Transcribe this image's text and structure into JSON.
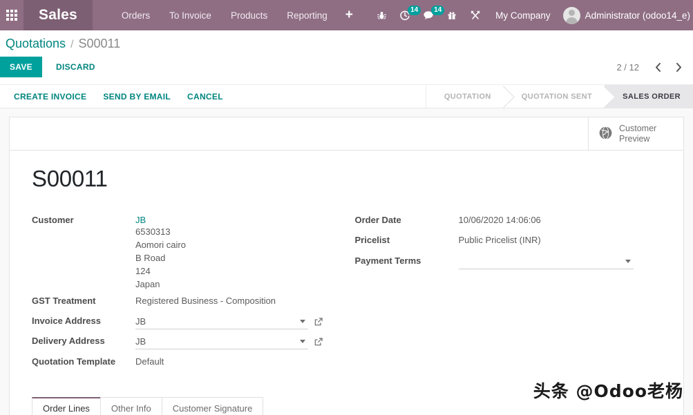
{
  "navbar": {
    "apps_icon": "apps-grid-icon",
    "brand": "Sales",
    "menu_items": [
      {
        "label": "Orders"
      },
      {
        "label": "To Invoice"
      },
      {
        "label": "Products"
      },
      {
        "label": "Reporting"
      }
    ],
    "plus_label": "+",
    "systray": [
      {
        "name": "debug-bug-icon",
        "badge": ""
      },
      {
        "name": "activity-clock-icon",
        "badge": "14"
      },
      {
        "name": "messages-chat-icon",
        "badge": "14"
      },
      {
        "name": "gift-icon",
        "badge": ""
      },
      {
        "name": "tools-wrench-icon",
        "badge": ""
      }
    ],
    "company": "My Company",
    "user": "Administrator (odoo14_e)",
    "badge_color": "#00a09d",
    "bg_color": "#8f6e84",
    "brand_bg_color": "#7d5f74"
  },
  "control_panel": {
    "breadcrumb": {
      "parent": "Quotations",
      "separator": "/",
      "current": "S00011"
    },
    "save_label": "SAVE",
    "discard_label": "DISCARD",
    "pager": {
      "value": "2 / 12",
      "prev_icon": "chevron-left-icon",
      "next_icon": "chevron-right-icon"
    },
    "object_buttons": [
      {
        "label": "CREATE INVOICE"
      },
      {
        "label": "SEND BY EMAIL"
      },
      {
        "label": "CANCEL"
      }
    ],
    "statusbar": [
      {
        "label": "QUOTATION",
        "active": false
      },
      {
        "label": "QUOTATION SENT",
        "active": false
      },
      {
        "label": "SALES ORDER",
        "active": true
      }
    ],
    "accent_color": "#00a09d",
    "link_color": "#00857f"
  },
  "sheet": {
    "stat_button": {
      "icon": "globe-icon",
      "line1": "Customer",
      "line2": "Preview"
    },
    "title": "S00011",
    "left_fields": {
      "customer_label": "Customer",
      "customer_name": "JB",
      "customer_address": [
        "6530313",
        "Aomori cairo",
        "B Road",
        "124",
        "Japan"
      ],
      "gst_label": "GST Treatment",
      "gst_value": "Registered Business - Composition",
      "invoice_address_label": "Invoice Address",
      "invoice_address_value": "JB",
      "delivery_address_label": "Delivery Address",
      "delivery_address_value": "JB",
      "quotation_template_label": "Quotation Template",
      "quotation_template_value": "Default"
    },
    "right_fields": {
      "order_date_label": "Order Date",
      "order_date_value": "10/06/2020 14:06:06",
      "pricelist_label": "Pricelist",
      "pricelist_value": "Public Pricelist (INR)",
      "payment_terms_label": "Payment Terms",
      "payment_terms_value": ""
    },
    "tabs": [
      {
        "label": "Order Lines",
        "active": true
      },
      {
        "label": "Other Info",
        "active": false
      },
      {
        "label": "Customer Signature",
        "active": false
      }
    ]
  },
  "watermark": "头条 @Odoo老杨"
}
